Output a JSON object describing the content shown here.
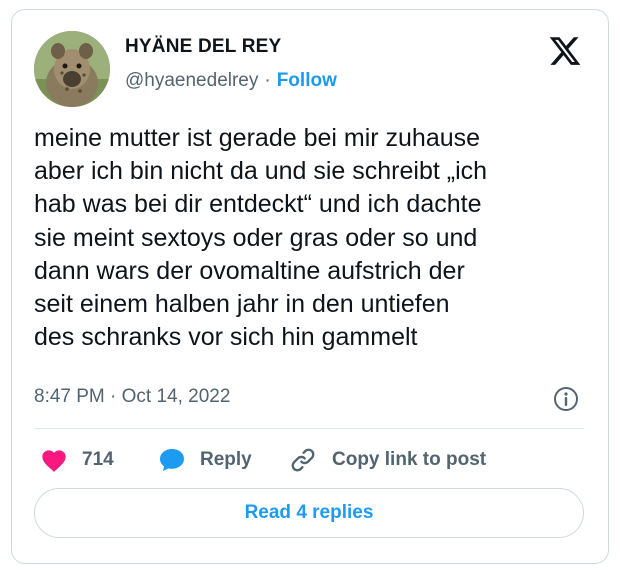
{
  "author": {
    "name": "HYÄNE DEL REY",
    "handle": "@hyaenedelrey",
    "separator": "·",
    "follow_label": "Follow"
  },
  "tweet": {
    "lines": [
      "meine mutter ist gerade bei mir zuhause",
      "aber ich bin nicht da und sie schreibt „ich",
      "hab was bei dir entdeckt“ und ich dachte",
      "sie meint sextoys oder gras oder so und",
      "dann wars der ovomaltine aufstrich der",
      "seit einem halben jahr in den untiefen",
      "des schranks vor sich hin gammelt"
    ],
    "timestamp": "8:47 PM · Oct 14, 2022"
  },
  "actions": {
    "likes_count": "714",
    "reply_label": "Reply",
    "copy_label": "Copy link to post"
  },
  "footer": {
    "read_replies_label": "Read 4 replies"
  },
  "icons": {
    "logo": "x-logo-icon",
    "info": "info-icon",
    "like": "heart-icon",
    "reply": "speech-bubble-icon",
    "copy": "link-icon"
  },
  "colors": {
    "accent": "#1d9bf0",
    "heart": "#f91880",
    "muted": "#536471",
    "border": "#cfd9de"
  }
}
